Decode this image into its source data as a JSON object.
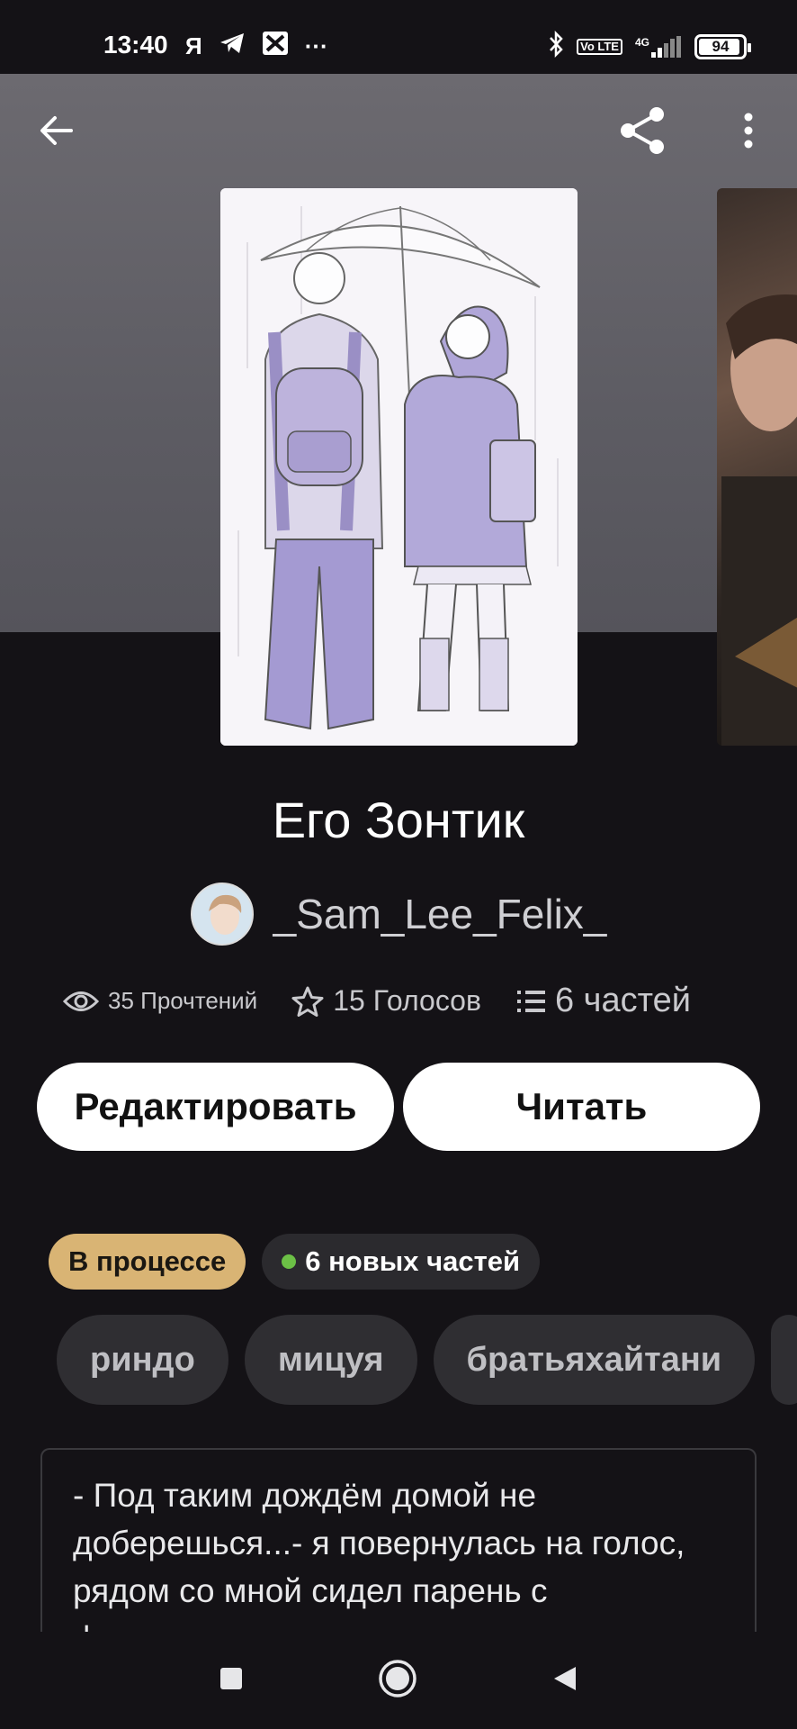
{
  "status_bar": {
    "time": "13:40",
    "left_icons": [
      "yandex-icon",
      "telegram-icon",
      "app-icon",
      "more-dots-icon"
    ],
    "ya_label": "Я",
    "more_label": "···",
    "volte_label": "Vo LTE",
    "network_label": "4G",
    "battery_percent": 94,
    "battery_label": "94"
  },
  "toolbar": {
    "back_icon": "arrow-left-icon",
    "share_icon": "share-icon",
    "menu_icon": "more-vertical-icon"
  },
  "story": {
    "title": "Его Зонтик",
    "author": "_Sam_Lee_Felix_",
    "stats": {
      "reads": "35 Прочтений",
      "votes": "15 Голосов",
      "parts": "6 частей"
    },
    "buttons": {
      "edit": "Редактировать",
      "read": "Читать"
    },
    "badges": {
      "status": "В процессе",
      "new_parts": "6 новых частей"
    },
    "tags": [
      "риндо",
      "мицуя",
      "братьяхайтани"
    ],
    "description": "- Под таким дождём домой не доберешься...- я повернулась на голос, рядом со мной сидел парень с фиолетовыми волосами"
  },
  "colors": {
    "background": "#141216",
    "status_badge": "#d9b474",
    "new_dot": "#6cc046",
    "tag_bg": "#2f2e32"
  },
  "nav": {
    "recent_icon": "square-icon",
    "home_icon": "circle-icon",
    "back_icon": "triangle-back-icon"
  }
}
